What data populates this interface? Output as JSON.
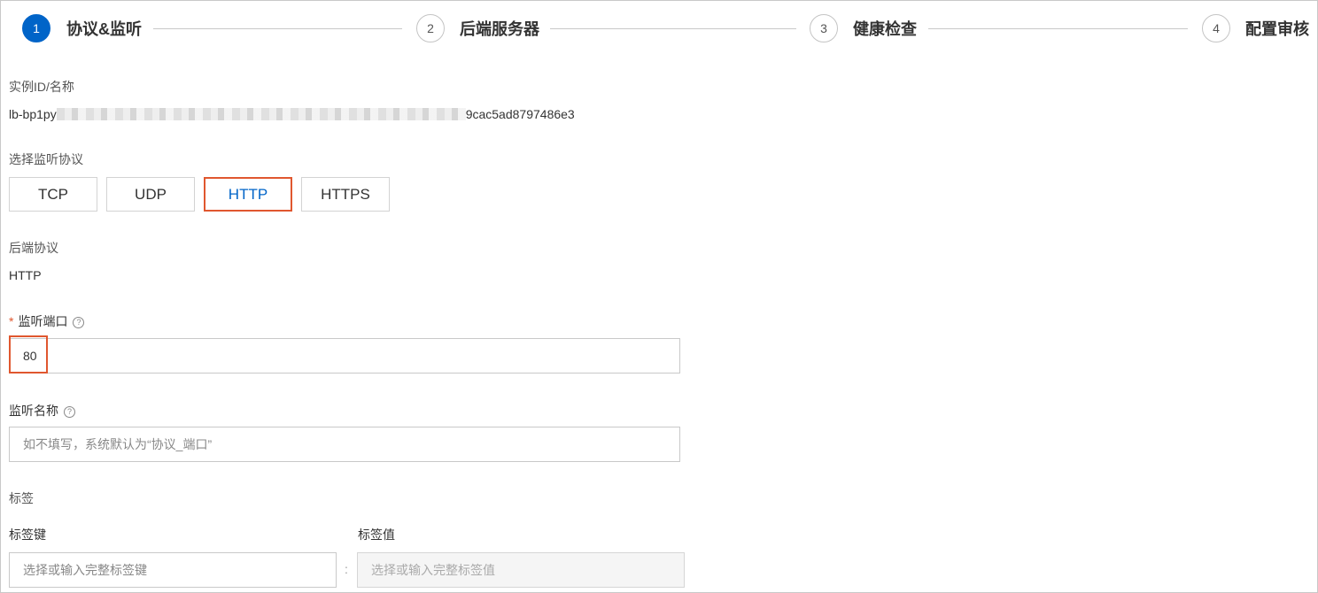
{
  "stepper": {
    "steps": [
      {
        "number": "1",
        "title": "协议&监听"
      },
      {
        "number": "2",
        "title": "后端服务器"
      },
      {
        "number": "3",
        "title": "健康检查"
      },
      {
        "number": "4",
        "title": "配置审核"
      }
    ],
    "active_step": 1
  },
  "instance": {
    "label": "实例ID/名称",
    "id_prefix": "lb-bp1py",
    "id_suffix": "9cac5ad8797486e3"
  },
  "listener_protocol": {
    "label": "选择监听协议",
    "options": [
      "TCP",
      "UDP",
      "HTTP",
      "HTTPS"
    ],
    "selected": "HTTP"
  },
  "backend_protocol": {
    "label": "后端协议",
    "value": "HTTP"
  },
  "listen_port": {
    "required_mark": "*",
    "label": "监听端口",
    "help_icon": "question-circle-icon",
    "value": "80"
  },
  "listen_name": {
    "label": "监听名称",
    "help_icon": "question-circle-icon",
    "placeholder": "如不填写，系统默认为“协议_端口”"
  },
  "tags": {
    "label": "标签",
    "key_label": "标签键",
    "value_label": "标签值",
    "key_placeholder": "选择或输入完整标签键",
    "value_placeholder": "选择或输入完整标签值",
    "separator": ":"
  },
  "colors": {
    "primary": "#0064c8",
    "highlight": "#e0572f"
  }
}
